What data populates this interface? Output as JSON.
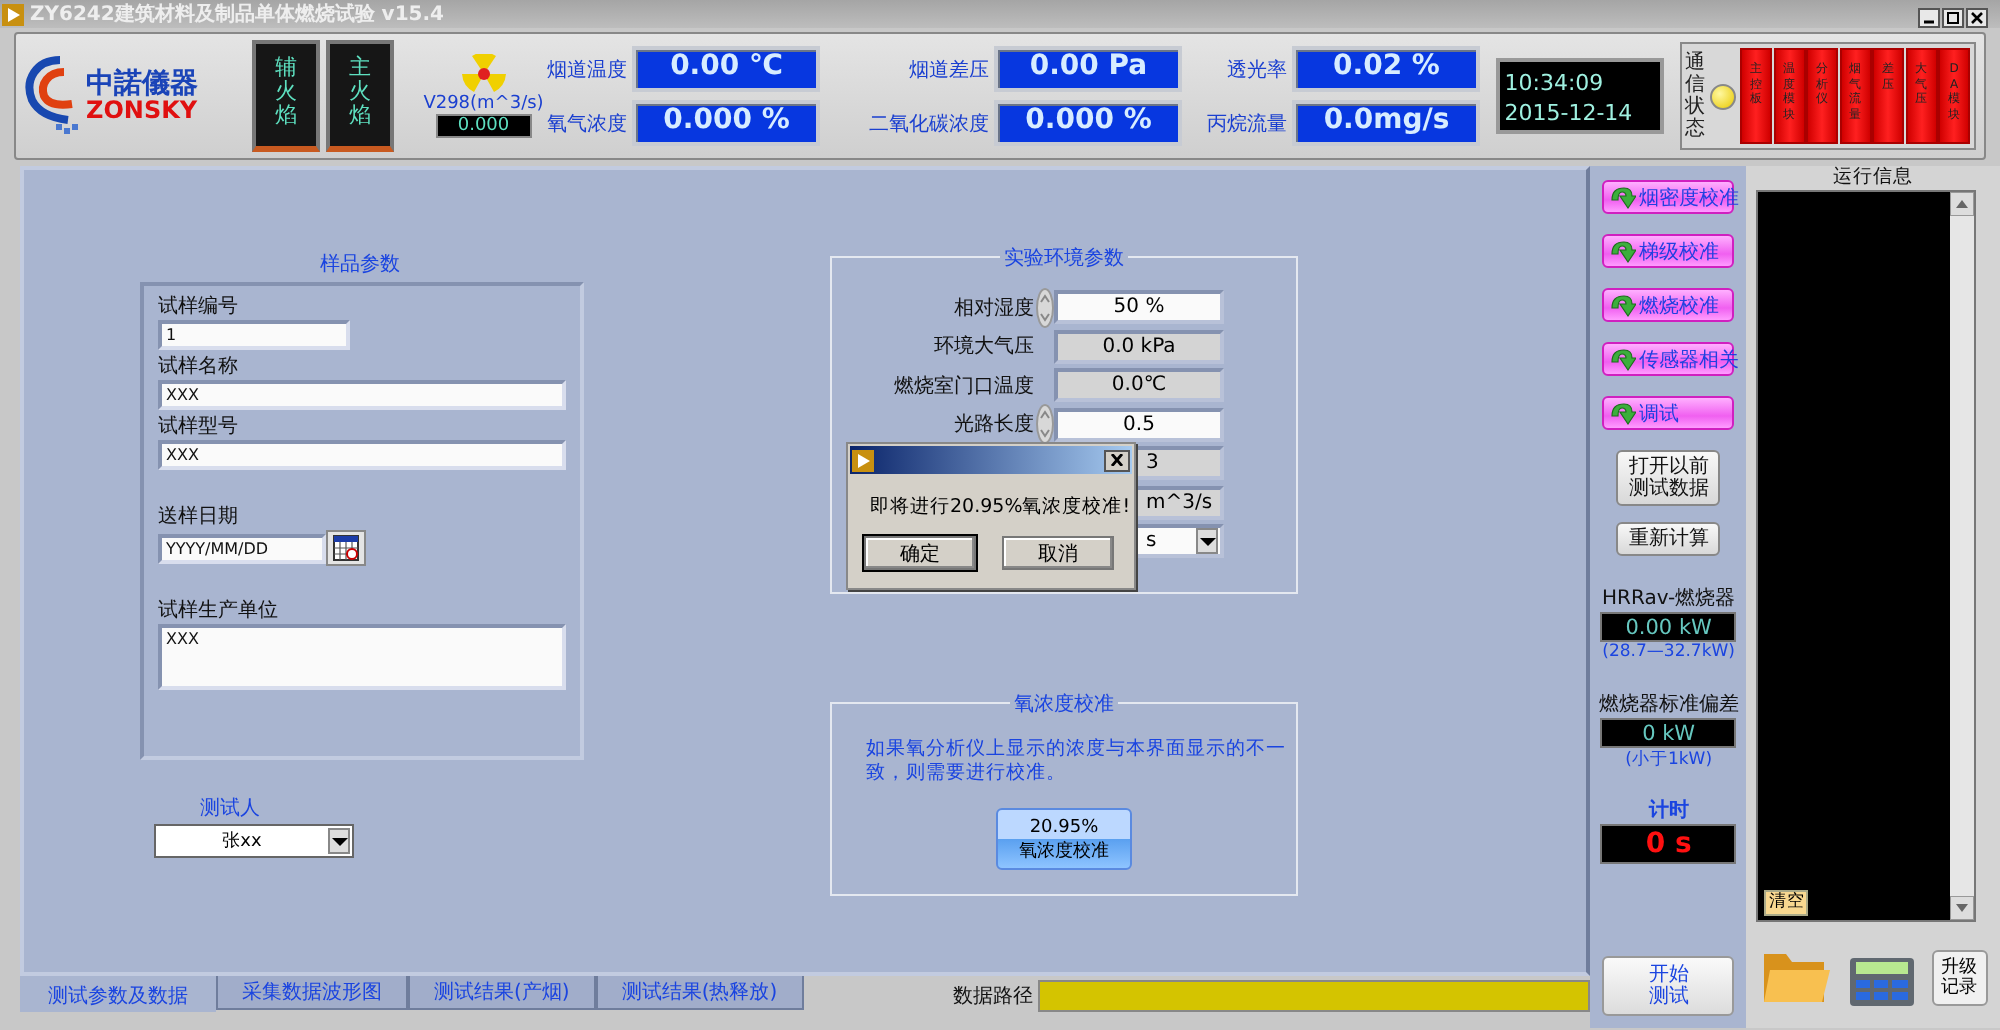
{
  "window": {
    "title": "ZY6242建筑材料及制品单体燃烧试验 v15.4"
  },
  "header": {
    "logo": {
      "name": "中諾儀器",
      "brand": "ZONSKY"
    },
    "flames": [
      {
        "label": "辅火焰"
      },
      {
        "label": "主火焰"
      }
    ],
    "v298": {
      "label": "V298(m^3/s)",
      "value": "0.000"
    },
    "readouts": [
      {
        "label": "烟道温度",
        "value": "0.00 ℃"
      },
      {
        "label": "烟道差压",
        "value": "0.00 Pa"
      },
      {
        "label": "透光率",
        "value": "0.02 %"
      },
      {
        "label": "氧气浓度",
        "value": "0.000 %"
      },
      {
        "label": "二氧化碳浓度",
        "value": "0.000 %"
      },
      {
        "label": "丙烷流量",
        "value": "0.0mg/s"
      }
    ],
    "clock": {
      "time": "10:34:09",
      "date": "2015-12-14"
    },
    "comm": {
      "label": "通信状态",
      "lamp_on": true,
      "indicators": [
        {
          "label": "主控板",
          "on": false
        },
        {
          "label": "温度模块",
          "on": false
        },
        {
          "label": "分析仪",
          "on": false
        },
        {
          "label": "烟气流量",
          "on": false
        },
        {
          "label": "差压",
          "on": false
        },
        {
          "label": "大气压",
          "on": false
        },
        {
          "label": "DA模块",
          "on": false
        }
      ]
    }
  },
  "sample": {
    "title": "样品参数",
    "fields": [
      {
        "kind": "text",
        "label": "试样编号",
        "value": "1"
      },
      {
        "kind": "text",
        "label": "试样名称",
        "value": "XXX"
      },
      {
        "kind": "text",
        "label": "试样型号",
        "value": "XXX"
      },
      {
        "kind": "date",
        "label": "送样日期",
        "value": "YYYY/MM/DD"
      },
      {
        "kind": "area",
        "label": "试样生产单位",
        "value": "XXX"
      }
    ],
    "tester": {
      "label": "测试人",
      "value": "张xx"
    }
  },
  "environment": {
    "title": "实验环境参数",
    "rows": [
      {
        "kind": "spin",
        "label": "相对湿度",
        "value": "50 %"
      },
      {
        "kind": "readonly",
        "label": "环境大气压",
        "value": "0.0 kPa"
      },
      {
        "kind": "readonly",
        "label": "燃烧室门口温度",
        "value": "0.0℃"
      },
      {
        "kind": "spin",
        "label": "光路长度",
        "value": "0.5"
      },
      {
        "kind": "readonly",
        "value": "3"
      },
      {
        "kind": "readonly",
        "value": "m^3/s"
      },
      {
        "kind": "dropdown",
        "value": "s"
      }
    ]
  },
  "o2_calibration": {
    "title": "氧浓度校准",
    "note": "如果氧分析仪上显示的浓度与本界面显示的不一致，则需要进行校准。",
    "button": [
      "20.95%",
      "氧浓度校准"
    ]
  },
  "dialog": {
    "message": "即将进行20.95%氧浓度校准!",
    "buttons": [
      {
        "label": "确定",
        "default": true
      },
      {
        "label": "取消",
        "default": false
      }
    ]
  },
  "side": {
    "calibration_buttons": [
      "烟密度校准",
      "梯级校准",
      "燃烧校准",
      "传感器相关",
      "调试"
    ],
    "buttons": [
      [
        "打开以前",
        "测试数据"
      ],
      [
        "重新计算"
      ]
    ],
    "hrr": {
      "label": "HRRav-燃烧器",
      "value": "0.00 kW",
      "range": "(28.7—32.7kW)"
    },
    "deviation": {
      "label": "燃烧器标准偏差",
      "value": "0 kW",
      "range": "(小于1kW)"
    },
    "timer": {
      "label": "计时",
      "value": "0 s"
    },
    "start": [
      "开始",
      "测试"
    ]
  },
  "run_info": {
    "title": "运行信息",
    "clear": "清空",
    "upgrade": [
      "升级",
      "记录"
    ]
  },
  "tabs": [
    {
      "label": "测试参数及数据",
      "selected": true
    },
    {
      "label": "采集数据波形图",
      "selected": false
    },
    {
      "label": "测试结果(产烟)",
      "selected": false
    },
    {
      "label": "测试结果(热释放)",
      "selected": false
    }
  ],
  "data_path": {
    "label": "数据路径"
  }
}
